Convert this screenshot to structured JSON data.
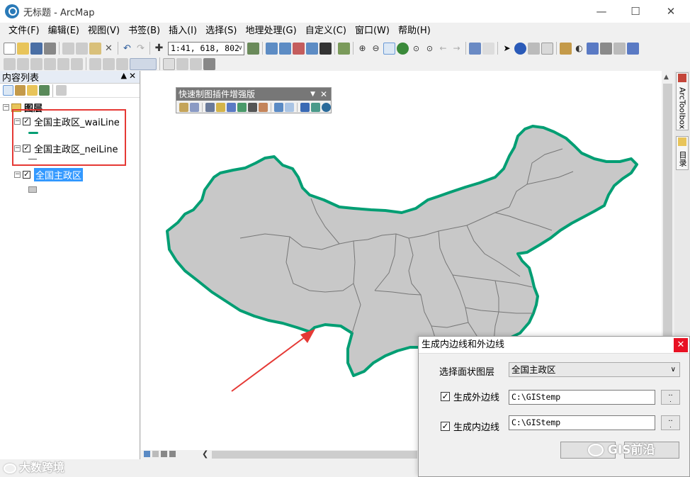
{
  "window": {
    "title": "无标题 - ArcMap"
  },
  "menu": [
    "文件(F)",
    "编辑(E)",
    "视图(V)",
    "书签(B)",
    "插入(I)",
    "选择(S)",
    "地理处理(G)",
    "自定义(C)",
    "窗口(W)",
    "帮助(H)"
  ],
  "toolbar": {
    "scale": "1:41, 618, 802"
  },
  "toc": {
    "title": "内容列表",
    "root": "图层",
    "layers": [
      {
        "name": "全国主政区_waiLine",
        "checked": true,
        "symbol_color": "#009e73"
      },
      {
        "name": "全国主政区_neiLine",
        "checked": true,
        "symbol_color": "#555555"
      },
      {
        "name": "全国主政区",
        "checked": true,
        "symbol_color": "#c8c8c8",
        "selected": true
      }
    ]
  },
  "float_toolbar": {
    "title": "快速制图插件增强版"
  },
  "side_tabs": [
    "ArcToolbox",
    "目录"
  ],
  "dialog": {
    "title": "生成内边线和外边线",
    "select_label": "选择面状图层",
    "select_value": "全国主政区",
    "outer_label": "生成外边线",
    "outer_checked": true,
    "outer_path": "C:\\GIStemp",
    "inner_label": "生成内边线",
    "inner_checked": true,
    "inner_path": "C:\\GIStemp",
    "browse_label": ".."
  },
  "watermarks": {
    "left": "大数跨境",
    "right": "GIS前沿"
  },
  "colors": {
    "outline": "#009e73",
    "fill": "#c8c8c8",
    "internal": "#777777",
    "arrow": "#e53935"
  }
}
